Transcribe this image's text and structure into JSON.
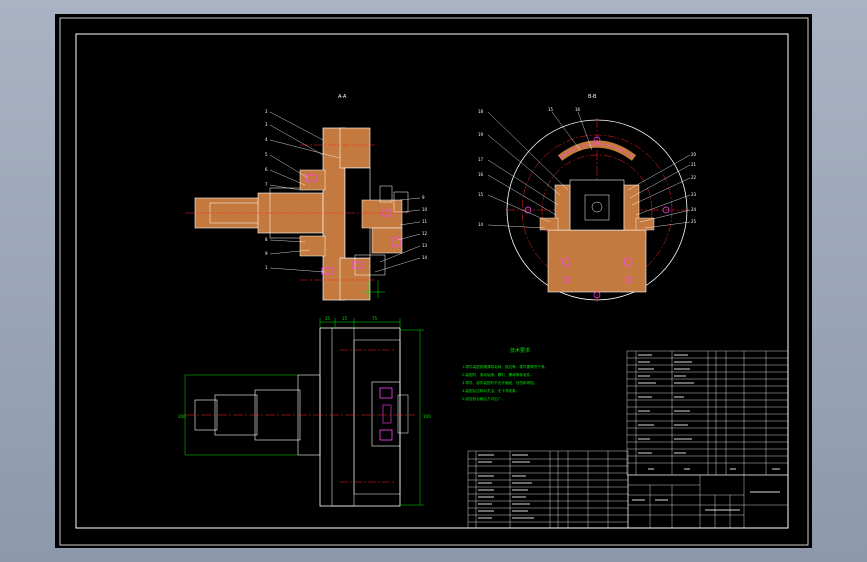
{
  "drawing": {
    "section_aa_label": "A-A",
    "section_bb_label": "B-B",
    "tech_requirements_title": "技术要求",
    "tech_requirements_lines": [
      "1.零件装配前需清除毛刺、锐边等，零件需清洗干净。",
      "2.装配时，滚动轴承、螺钉、螺母等标准件。",
      "3.零件、部件装配时不允许磕碰、划伤和锈蚀。",
      "4.装配后应转动灵活，无卡滞现象。",
      "5.经检验合格后方可出厂。"
    ],
    "part_numbers_left": [
      "2",
      "3",
      "4",
      "5",
      "6",
      "7",
      "8",
      "9",
      "1"
    ],
    "part_numbers_right_a": [
      "9",
      "10",
      "11",
      "12",
      "13",
      "14"
    ],
    "part_numbers_bb_left": [
      "18",
      "19",
      "17",
      "16",
      "15",
      "14"
    ],
    "part_numbers_bb_right": [
      "20",
      "21",
      "22",
      "23",
      "24",
      "25"
    ],
    "part_numbers_bb_top": [
      "15",
      "16"
    ],
    "dim_top": [
      "25",
      "15",
      "75"
    ],
    "dim_side": "200",
    "dim_side_right": "100"
  },
  "colors": {
    "sheet": "#000000",
    "outline": "#ffffff",
    "section_fill": "#c47a3f",
    "center_line": "#ff2020",
    "dimension": "#00e000",
    "hidden": "#ff00ff",
    "highlight": "#ff40ff"
  }
}
